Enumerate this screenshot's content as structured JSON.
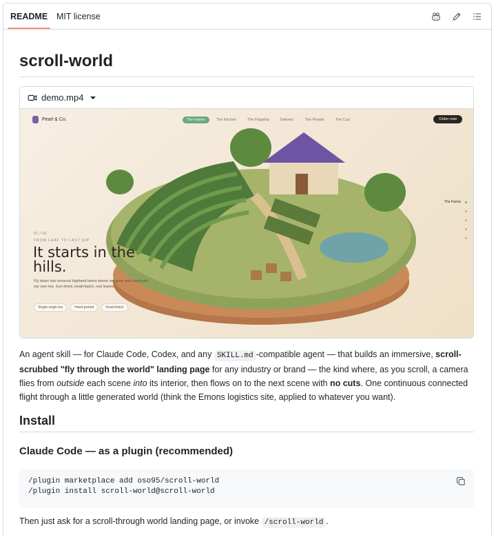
{
  "tabs": {
    "readme": "README",
    "license": "MIT license",
    "actions": [
      "copilot-icon",
      "pencil-icon",
      "list-icon"
    ]
  },
  "readme": {
    "title": "scroll-world",
    "video": {
      "filename": "demo.mp4"
    },
    "demo_site": {
      "brand": "Pearl & Co.",
      "nav": [
        "The Farms",
        "The Kitchen",
        "The Flagship",
        "Delivery",
        "The People",
        "The Cup"
      ],
      "active_nav": "The Farms",
      "order_button": "Order now",
      "kicker_index": "01 / 06",
      "kicker": "FROM LEAF TO LAST SIP",
      "hero_title": "It starts in the hills.",
      "hero_desc": "Fly down into terraced highland farms where we grow and hand-pick our own tea. Sun-dried, small-batch, real leaves.",
      "chips": [
        "Single-origin tea",
        "Hand-picked",
        "Small-batch"
      ],
      "side_label": "The Farms"
    },
    "intro": {
      "p1": "An agent skill — for Claude Code, Codex, and any ",
      "code1": "SKILL.md",
      "p2": "-compatible agent — that builds an immersive, ",
      "bold1": "scroll-scrubbed \"fly through the world\" landing page",
      "p3": " for any industry or brand — the kind where, as you scroll, a camera flies from ",
      "em1": "outside",
      "p4": " each scene ",
      "em2": "into",
      "p5": " its interior, then flows on to the next scene with ",
      "bold2": "no cuts",
      "p6": ". One continuous connected flight through a little generated world (think the Emons logistics site, applied to whatever you want)."
    },
    "install_heading": "Install",
    "plugin_heading": "Claude Code — as a plugin (recommended)",
    "code_lines": [
      "/plugin marketplace add oso95/scroll-world",
      "/plugin install scroll-world@scroll-world"
    ],
    "outro": {
      "text": "Then just ask for a scroll-through world landing page, or invoke ",
      "code": "/scroll-world",
      "end": "."
    }
  }
}
